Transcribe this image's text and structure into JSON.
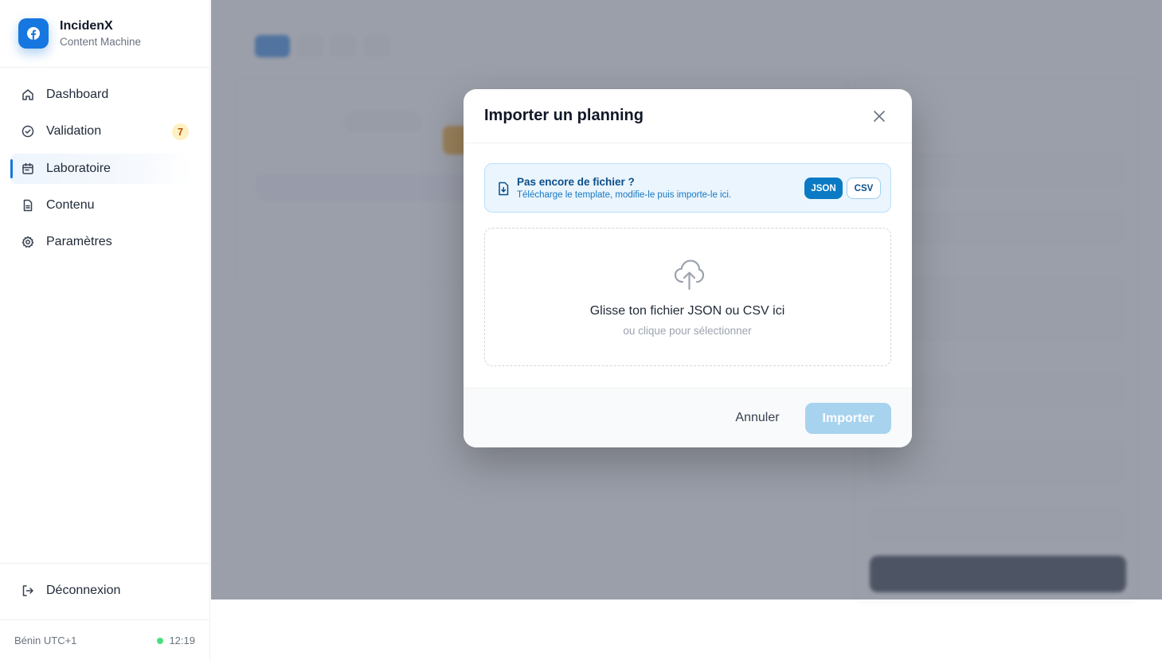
{
  "brand": {
    "name": "IncidenX",
    "subtitle": "Content Machine"
  },
  "sidebar": {
    "items": [
      {
        "label": "Dashboard",
        "icon": "home-icon"
      },
      {
        "label": "Validation",
        "icon": "check-circle-icon",
        "badge": "7"
      },
      {
        "label": "Laboratoire",
        "icon": "calendar-icon",
        "active": true
      },
      {
        "label": "Contenu",
        "icon": "document-icon"
      },
      {
        "label": "Paramètres",
        "icon": "gear-icon"
      }
    ],
    "logout": {
      "label": "Déconnexion",
      "icon": "logout-icon"
    },
    "footer": {
      "timezone": "Bénin UTC+1",
      "time": "12:19",
      "status_color": "#4ade80"
    }
  },
  "modal": {
    "title": "Importer un planning",
    "info": {
      "title": "Pas encore de fichier ?",
      "subtitle": "Télécharge le template, modifie-le puis importe-le ici.",
      "json_label": "JSON",
      "csv_label": "CSV"
    },
    "dropzone": {
      "title": "Glisse ton fichier JSON ou CSV ici",
      "subtitle": "ou clique pour sélectionner"
    },
    "cancel_label": "Annuler",
    "import_label": "Importer"
  },
  "colors": {
    "accent": "#1677e0",
    "import_disabled": "#a7d3ef",
    "info_bg": "#eaf5fd"
  }
}
